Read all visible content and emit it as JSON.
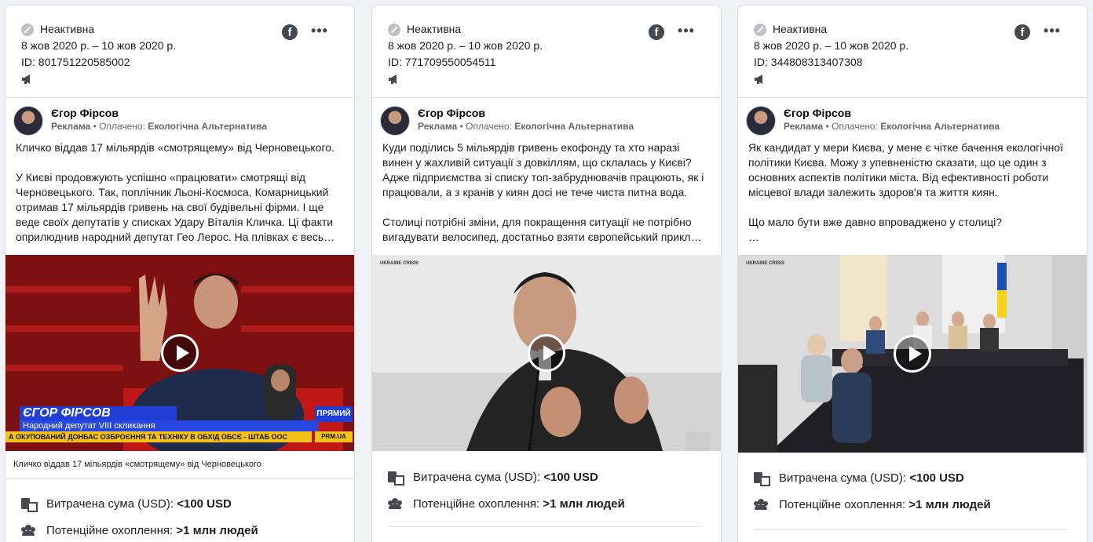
{
  "cards": [
    {
      "status": "Неактивна",
      "dates": "8 жов 2020 р. – 10 жов 2020 р.",
      "id": "ID: 801751220585002",
      "page_name": "Єгор Фірсов",
      "ad_label": "Реклама",
      "paid_prefix": "Оплачено:",
      "payer": "Екологічна Альтернатива",
      "text": "Кличко віддав 17 мільярдів «смотрящему» від Черновецького.\n\nУ Києві продовжують успішно «працювати» смотрящі від Черновецького. Так, поплічник Льоні-Космоса, Комарницький отримав 17 мільярдів гривень на свої будівельні фірми. І ще веде своїх депутатів у списках Удару Віталія Кличка. Ці факти оприлюднив народний депутат Гео Лерос. На плівках є весь…",
      "video_caption": "Кличко віддав 17 мільярдів «смотрящему» від Черновецького",
      "overlay_name": "ЄГОР ФІРСОВ",
      "overlay_title": "Народний депутат VIII скликання",
      "overlay_ticker": "А ОКУПОВАНИЙ ДОНБАС ОЗБРОЄННЯ ТА ТЕХНІКУ В ОБХІД ОБСЄ - ШТАБ ООС",
      "overlay_live": "ПРЯМИЙ",
      "overlay_site": "PRM.UA",
      "spend_label": "Витрачена сума (USD):",
      "spend_value": "<100 USD",
      "reach_label": "Потенційне охоплення:",
      "reach_value": ">1 млн людей"
    },
    {
      "status": "Неактивна",
      "dates": "8 жов 2020 р. – 10 жов 2020 р.",
      "id": "ID: 771709550054511",
      "page_name": "Єгор Фірсов",
      "ad_label": "Реклама",
      "paid_prefix": "Оплачено:",
      "payer": "Екологічна Альтернатива",
      "text": "Куди поділись 5 мільярдів гривень екофонду та хто наразі винен у жахливій ситуації з довкіллям, що склалась у Києві? Адже підприємства зі списку топ-забруднювачів працюють, як і працювали, а з кранів у киян досі не тече чиста питна вода.\n\nСтолиці потрібні зміни, для покращення ситуації не потрібно вигадувати велосипед, достатньо взяти європейський прикл…",
      "logo_text": "UKRAINE CRISIS",
      "spend_label": "Витрачена сума (USD):",
      "spend_value": "<100 USD",
      "reach_label": "Потенційне охоплення:",
      "reach_value": ">1 млн людей"
    },
    {
      "status": "Неактивна",
      "dates": "8 жов 2020 р. – 10 жов 2020 р.",
      "id": "ID: 344808313407308",
      "page_name": "Єгор Фірсов",
      "ad_label": "Реклама",
      "paid_prefix": "Оплачено:",
      "payer": "Екологічна Альтернатива",
      "text": "Як кандидат у мери Києва, у мене є чітке бачення екологічної політики Києва. Можу з упевненістю сказати, що це один з основних аспектів політики міста. Від ефективності роботи місцевої влади залежить здоров'я та життя киян.\n\nЩо мало бути вже давно впроваджено у столиці?\n…",
      "logo_text": "UKRAINE CRISIS",
      "spend_label": "Витрачена сума (USD):",
      "spend_value": "<100 USD",
      "reach_label": "Потенційне охоплення:",
      "reach_value": ">1 млн людей"
    }
  ],
  "icons": {
    "status": "inactive-icon",
    "platform": "facebook-icon",
    "more": "more-icon",
    "placement": "megaphone-icon",
    "spend": "money-icon",
    "reach": "people-icon",
    "play": "play-icon"
  },
  "colors": {
    "background": "#f0f2f5",
    "card": "#ffffff",
    "border": "#dadde1",
    "muted": "#65676b",
    "tv_accent_blue": "#1f3fd6",
    "tv_accent_red": "#e8141d"
  }
}
